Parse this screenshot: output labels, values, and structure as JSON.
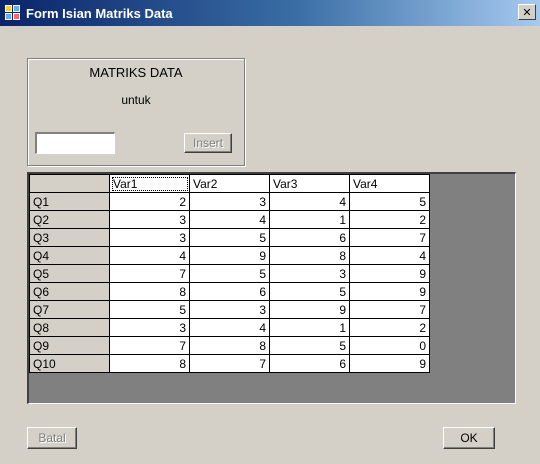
{
  "window": {
    "title": "Form Isian Matriks Data",
    "close_symbol": "✕"
  },
  "panel": {
    "title": "MATRIKS DATA",
    "subtitle": "untuk",
    "input_value": "",
    "insert_label": "Insert"
  },
  "grid": {
    "columns": [
      "Var1",
      "Var2",
      "Var3",
      "Var4"
    ],
    "rows": [
      {
        "label": "Q1",
        "values": [
          "2",
          "3",
          "4",
          "5"
        ]
      },
      {
        "label": "Q2",
        "values": [
          "3",
          "4",
          "1",
          "2"
        ]
      },
      {
        "label": "Q3",
        "values": [
          "3",
          "5",
          "6",
          "7"
        ]
      },
      {
        "label": "Q4",
        "values": [
          "4",
          "9",
          "8",
          "4"
        ]
      },
      {
        "label": "Q5",
        "values": [
          "7",
          "5",
          "3",
          "9"
        ]
      },
      {
        "label": "Q6",
        "values": [
          "8",
          "6",
          "5",
          "9"
        ]
      },
      {
        "label": "Q7",
        "values": [
          "5",
          "3",
          "9",
          "7"
        ]
      },
      {
        "label": "Q8",
        "values": [
          "3",
          "4",
          "1",
          "2"
        ]
      },
      {
        "label": "Q9",
        "values": [
          "7",
          "8",
          "5",
          "0"
        ]
      },
      {
        "label": "Q10",
        "values": [
          "8",
          "7",
          "6",
          "9"
        ]
      }
    ]
  },
  "footer": {
    "cancel_label": "Batal",
    "ok_label": "OK"
  },
  "icons": {
    "app": "form-app-icon",
    "close": "close-icon"
  }
}
